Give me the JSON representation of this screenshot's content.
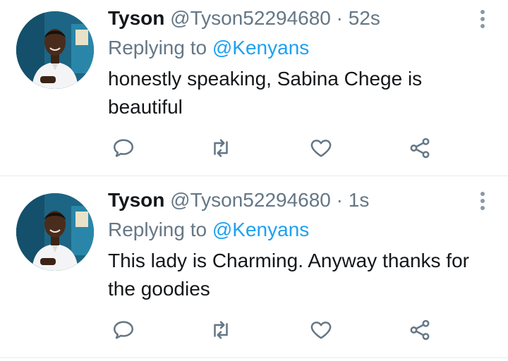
{
  "tweets": [
    {
      "name": "Tyson",
      "handle": "@Tyson52294680",
      "dot": "·",
      "time": "52s",
      "replying_prefix": "Replying to",
      "replying_to": "@Kenyans",
      "text": "honestly speaking, Sabina Chege is beautiful"
    },
    {
      "name": "Tyson",
      "handle": "@Tyson52294680",
      "dot": "·",
      "time": "1s",
      "replying_prefix": "Replying to",
      "replying_to": "@Kenyans",
      "text": "This lady is Charming. Anyway thanks for the goodies"
    }
  ],
  "icons": {
    "reply": "speech-bubble-icon",
    "retweet": "retweet-icon",
    "like": "heart-icon",
    "share": "share-icon",
    "more": "vertical-dots-icon"
  },
  "colors": {
    "name": "#14171a",
    "secondary": "#657786",
    "mention": "#1da1f2",
    "icon": "#657786",
    "divider": "#e6ecf0"
  }
}
